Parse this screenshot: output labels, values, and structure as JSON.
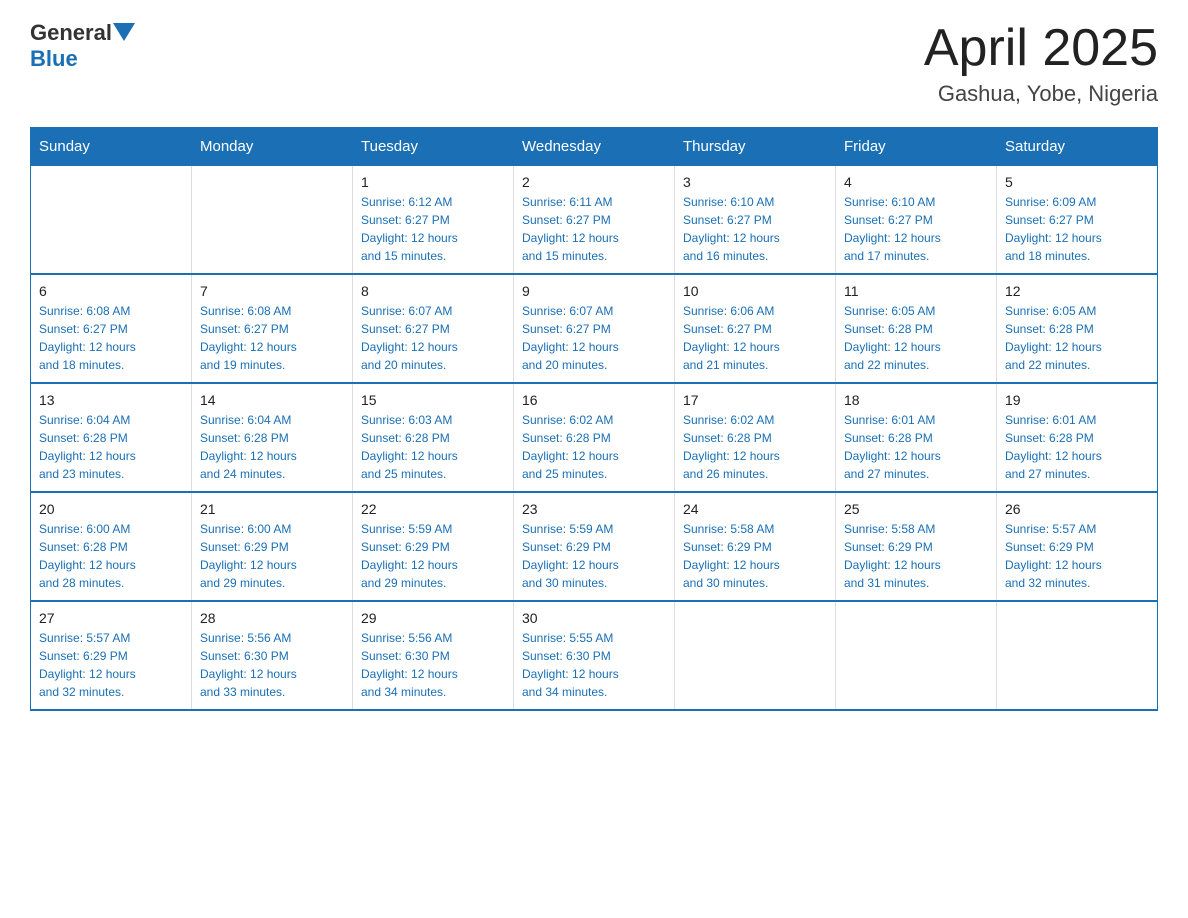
{
  "header": {
    "logo_general": "General",
    "logo_blue": "Blue",
    "month_title": "April 2025",
    "location": "Gashua, Yobe, Nigeria"
  },
  "days_of_week": [
    "Sunday",
    "Monday",
    "Tuesday",
    "Wednesday",
    "Thursday",
    "Friday",
    "Saturday"
  ],
  "weeks": [
    [
      {
        "day": "",
        "info": ""
      },
      {
        "day": "",
        "info": ""
      },
      {
        "day": "1",
        "info": "Sunrise: 6:12 AM\nSunset: 6:27 PM\nDaylight: 12 hours\nand 15 minutes."
      },
      {
        "day": "2",
        "info": "Sunrise: 6:11 AM\nSunset: 6:27 PM\nDaylight: 12 hours\nand 15 minutes."
      },
      {
        "day": "3",
        "info": "Sunrise: 6:10 AM\nSunset: 6:27 PM\nDaylight: 12 hours\nand 16 minutes."
      },
      {
        "day": "4",
        "info": "Sunrise: 6:10 AM\nSunset: 6:27 PM\nDaylight: 12 hours\nand 17 minutes."
      },
      {
        "day": "5",
        "info": "Sunrise: 6:09 AM\nSunset: 6:27 PM\nDaylight: 12 hours\nand 18 minutes."
      }
    ],
    [
      {
        "day": "6",
        "info": "Sunrise: 6:08 AM\nSunset: 6:27 PM\nDaylight: 12 hours\nand 18 minutes."
      },
      {
        "day": "7",
        "info": "Sunrise: 6:08 AM\nSunset: 6:27 PM\nDaylight: 12 hours\nand 19 minutes."
      },
      {
        "day": "8",
        "info": "Sunrise: 6:07 AM\nSunset: 6:27 PM\nDaylight: 12 hours\nand 20 minutes."
      },
      {
        "day": "9",
        "info": "Sunrise: 6:07 AM\nSunset: 6:27 PM\nDaylight: 12 hours\nand 20 minutes."
      },
      {
        "day": "10",
        "info": "Sunrise: 6:06 AM\nSunset: 6:27 PM\nDaylight: 12 hours\nand 21 minutes."
      },
      {
        "day": "11",
        "info": "Sunrise: 6:05 AM\nSunset: 6:28 PM\nDaylight: 12 hours\nand 22 minutes."
      },
      {
        "day": "12",
        "info": "Sunrise: 6:05 AM\nSunset: 6:28 PM\nDaylight: 12 hours\nand 22 minutes."
      }
    ],
    [
      {
        "day": "13",
        "info": "Sunrise: 6:04 AM\nSunset: 6:28 PM\nDaylight: 12 hours\nand 23 minutes."
      },
      {
        "day": "14",
        "info": "Sunrise: 6:04 AM\nSunset: 6:28 PM\nDaylight: 12 hours\nand 24 minutes."
      },
      {
        "day": "15",
        "info": "Sunrise: 6:03 AM\nSunset: 6:28 PM\nDaylight: 12 hours\nand 25 minutes."
      },
      {
        "day": "16",
        "info": "Sunrise: 6:02 AM\nSunset: 6:28 PM\nDaylight: 12 hours\nand 25 minutes."
      },
      {
        "day": "17",
        "info": "Sunrise: 6:02 AM\nSunset: 6:28 PM\nDaylight: 12 hours\nand 26 minutes."
      },
      {
        "day": "18",
        "info": "Sunrise: 6:01 AM\nSunset: 6:28 PM\nDaylight: 12 hours\nand 27 minutes."
      },
      {
        "day": "19",
        "info": "Sunrise: 6:01 AM\nSunset: 6:28 PM\nDaylight: 12 hours\nand 27 minutes."
      }
    ],
    [
      {
        "day": "20",
        "info": "Sunrise: 6:00 AM\nSunset: 6:28 PM\nDaylight: 12 hours\nand 28 minutes."
      },
      {
        "day": "21",
        "info": "Sunrise: 6:00 AM\nSunset: 6:29 PM\nDaylight: 12 hours\nand 29 minutes."
      },
      {
        "day": "22",
        "info": "Sunrise: 5:59 AM\nSunset: 6:29 PM\nDaylight: 12 hours\nand 29 minutes."
      },
      {
        "day": "23",
        "info": "Sunrise: 5:59 AM\nSunset: 6:29 PM\nDaylight: 12 hours\nand 30 minutes."
      },
      {
        "day": "24",
        "info": "Sunrise: 5:58 AM\nSunset: 6:29 PM\nDaylight: 12 hours\nand 30 minutes."
      },
      {
        "day": "25",
        "info": "Sunrise: 5:58 AM\nSunset: 6:29 PM\nDaylight: 12 hours\nand 31 minutes."
      },
      {
        "day": "26",
        "info": "Sunrise: 5:57 AM\nSunset: 6:29 PM\nDaylight: 12 hours\nand 32 minutes."
      }
    ],
    [
      {
        "day": "27",
        "info": "Sunrise: 5:57 AM\nSunset: 6:29 PM\nDaylight: 12 hours\nand 32 minutes."
      },
      {
        "day": "28",
        "info": "Sunrise: 5:56 AM\nSunset: 6:30 PM\nDaylight: 12 hours\nand 33 minutes."
      },
      {
        "day": "29",
        "info": "Sunrise: 5:56 AM\nSunset: 6:30 PM\nDaylight: 12 hours\nand 34 minutes."
      },
      {
        "day": "30",
        "info": "Sunrise: 5:55 AM\nSunset: 6:30 PM\nDaylight: 12 hours\nand 34 minutes."
      },
      {
        "day": "",
        "info": ""
      },
      {
        "day": "",
        "info": ""
      },
      {
        "day": "",
        "info": ""
      }
    ]
  ]
}
